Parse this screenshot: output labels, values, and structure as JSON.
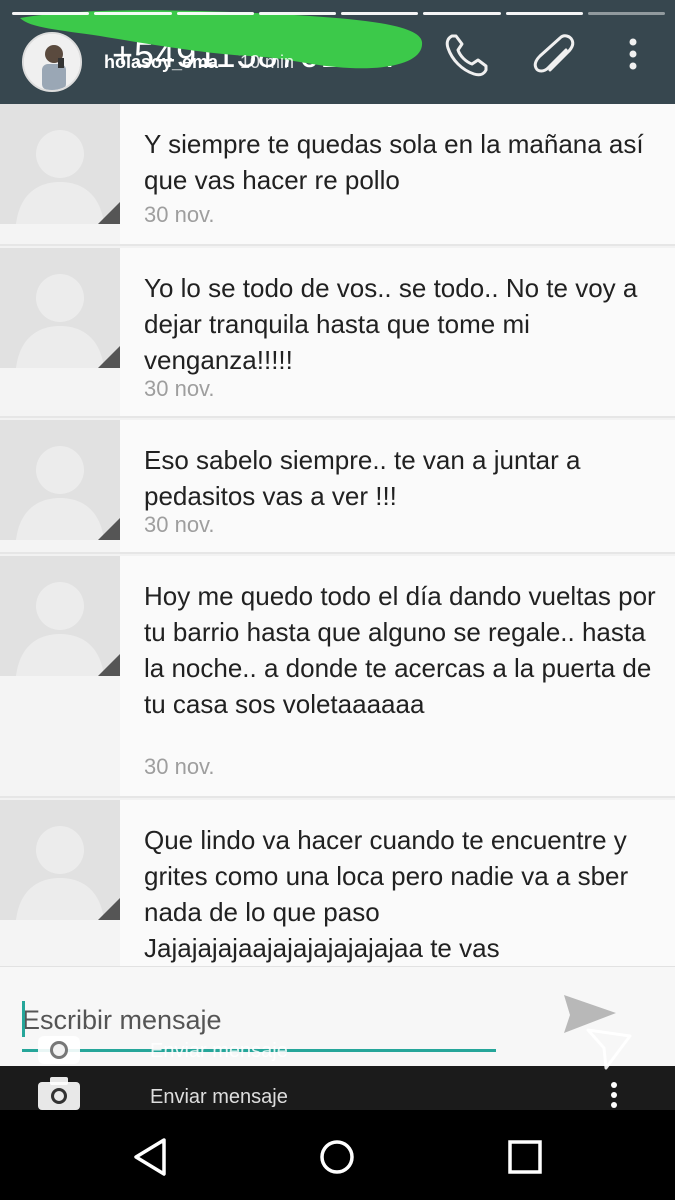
{
  "header": {
    "phone_number": "+54911587013...",
    "username": "holasoy_ema",
    "time_ago": "10 min"
  },
  "story": {
    "segments": 8,
    "completed": 7
  },
  "messages": [
    {
      "text": "Y siempre te quedas sola en la mañana así que vas hacer re pollo",
      "date": "30 nov."
    },
    {
      "text": "Yo lo se todo de vos.. se todo.. No te voy a dejar tranquila hasta que tome mi venganza!!!!!",
      "date": "30 nov."
    },
    {
      "text": "Eso sabelo siempre.. te van a juntar a pedasitos vas a ver !!!",
      "date": "30 nov."
    },
    {
      "text": "Hoy me quedo todo el día dando vueltas por tu barrio hasta que alguno se regale.. hasta la noche.. a donde te acercas a la puerta de tu casa sos voletaaaaaa",
      "date": "30 nov."
    },
    {
      "text": "Que lindo va hacer cuando te encuentre y grites como una loca pero nadie va a sber nada de lo que paso Jajajajajaajajajajajajajaa te vas",
      "date": ""
    }
  ],
  "compose": {
    "placeholder": "Escribir mensaje",
    "overlay_label": "Enviar mensaje"
  },
  "icons": {
    "call": "phone-icon",
    "attach": "paperclip-icon",
    "menu": "more-vertical-icon",
    "send": "send-icon",
    "camera": "camera-icon",
    "back": "back-icon",
    "home": "home-icon",
    "recents": "recents-icon"
  },
  "colors": {
    "header_bg": "#37474f",
    "accent": "#26a69a",
    "scribble": "#3cc94a"
  }
}
